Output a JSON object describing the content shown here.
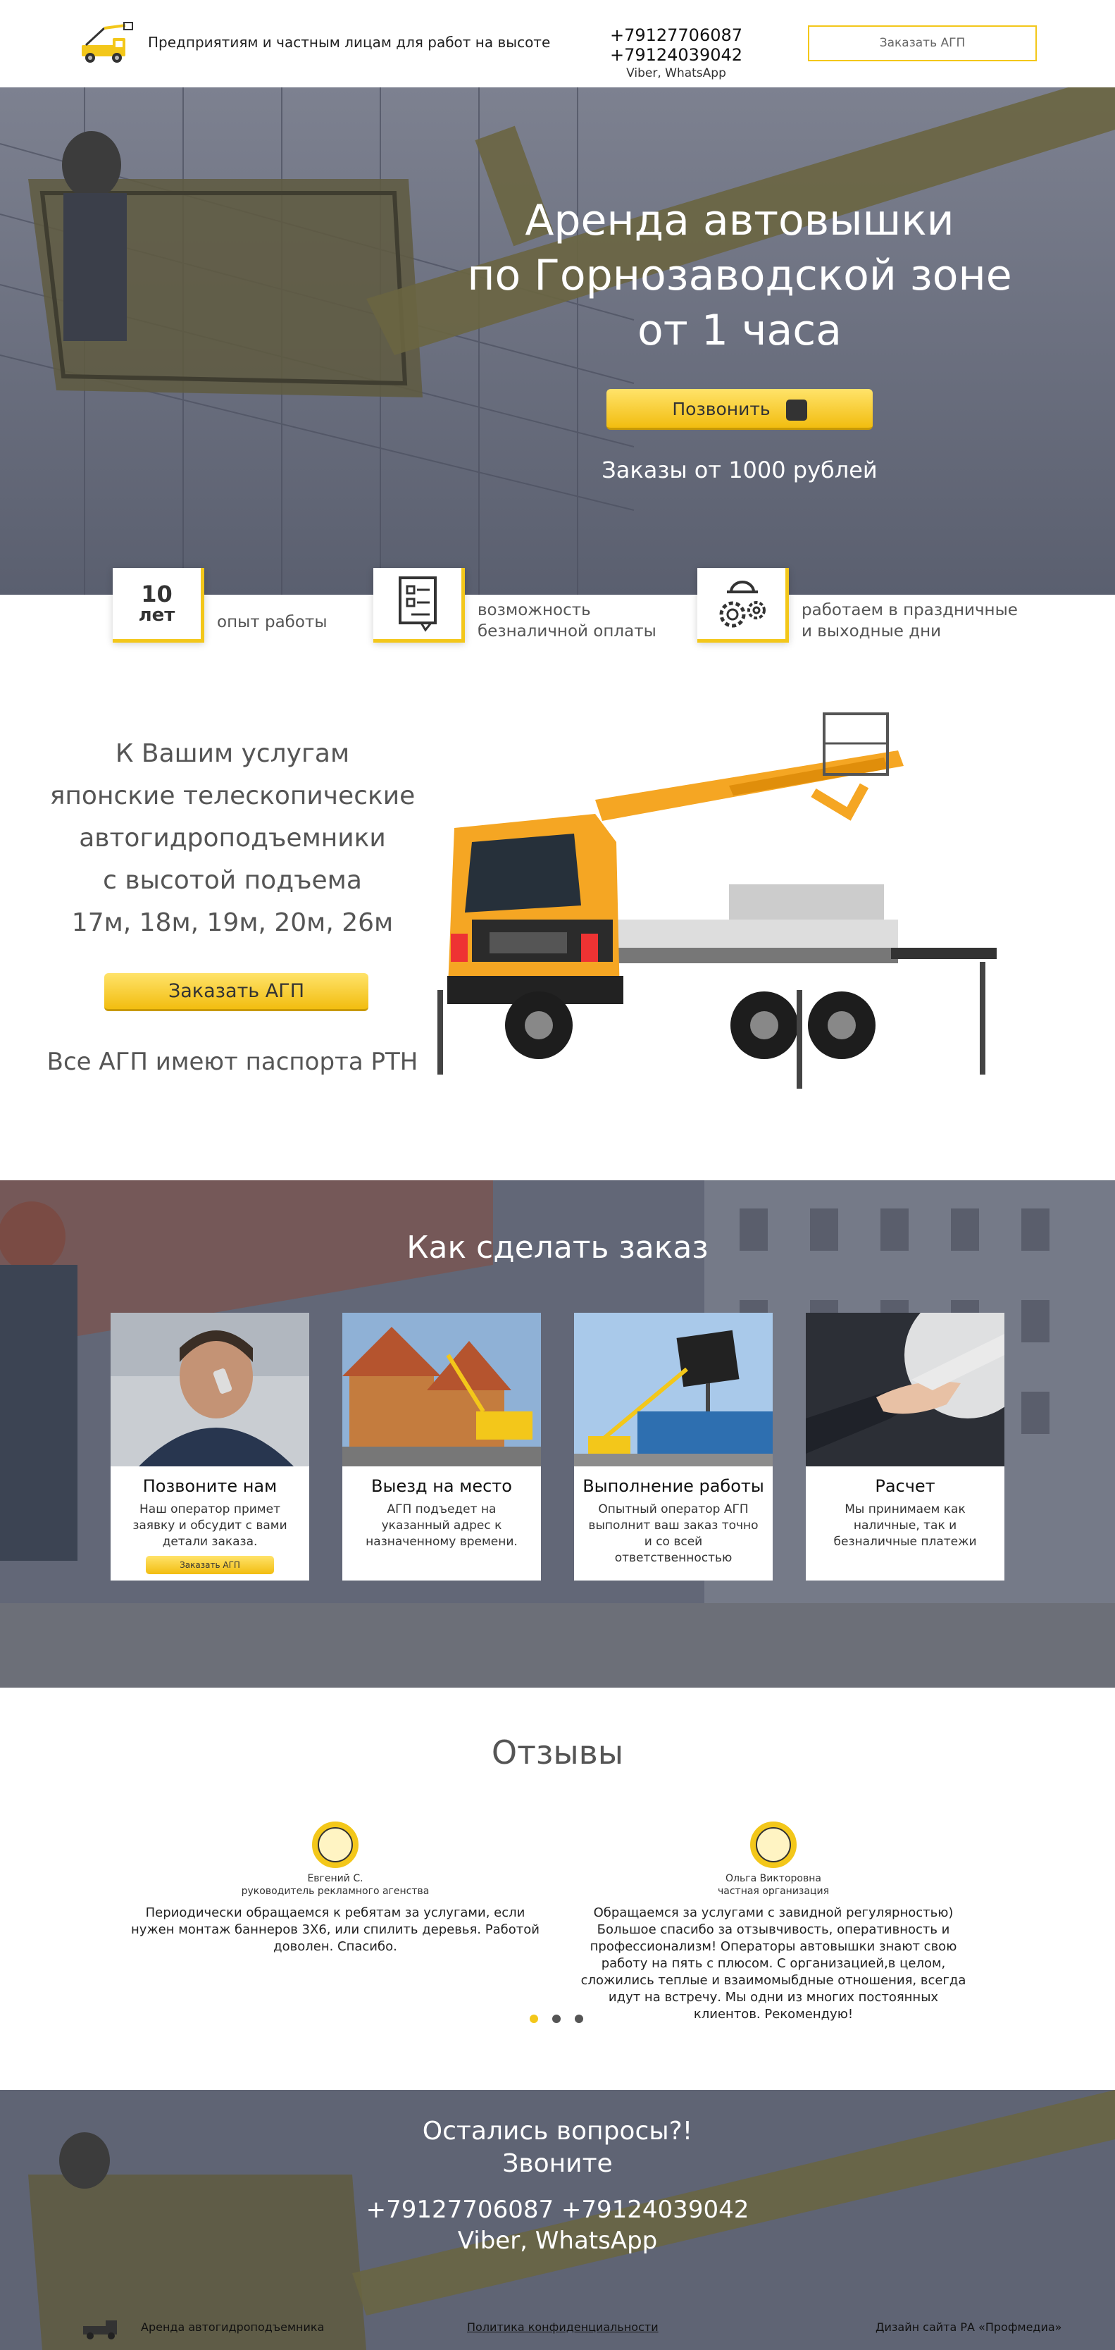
{
  "header": {
    "tagline": "Предприятиям и частным лицам для работ на высоте",
    "phones": "+79127706087  +79124039042",
    "messengers": "Viber, WhatsApp",
    "order_button": "Заказать АГП"
  },
  "hero": {
    "title_line1": "Аренда автовышки",
    "title_line2": "по Горнозаводской зоне",
    "title_line3": "от 1 часа",
    "call_button": "Позвонить",
    "subtitle": "Заказы от 1000 рублей"
  },
  "features": [
    {
      "badge_number": "10",
      "badge_unit": "лет",
      "text": "опыт работы",
      "icon": "ten-years-badge"
    },
    {
      "text_line1": "возможность",
      "text_line2": "безналичной оплаты",
      "icon": "document-checklist-icon"
    },
    {
      "text_line1": "работаем в праздничные",
      "text_line2": "и выходные дни",
      "icon": "gears-worker-icon"
    }
  ],
  "services": {
    "line1": "К Вашим услугам",
    "line2": "японские телескопические",
    "line3": "автогидроподъемники",
    "line4": "с высотой подъема",
    "line5": "17м, 18м, 19м, 20м, 26м",
    "order_button": "Заказать АГП",
    "note": "Все АГП имеют паспорта РТН"
  },
  "how_to_order": {
    "title": "Как сделать заказ",
    "cards": [
      {
        "title": "Позвоните нам",
        "text": "Наш оператор примет заявку и обсудит с вами детали заказа.",
        "button": "Заказать АГП"
      },
      {
        "title": "Выезд на место",
        "text": "АГП подъедет на указанный адрес к назначенному времени."
      },
      {
        "title": "Выполнение работы",
        "text": "Опытный оператор АГП выполнит ваш заказ точно и со всей ответственностью"
      },
      {
        "title": "Расчет",
        "text": "Мы принимаем как наличные, так и безналичные платежи"
      }
    ]
  },
  "reviews": {
    "title": "Отзывы",
    "items": [
      {
        "name": "Евгений С.",
        "role": "руководитель рекламного агенства",
        "text": "Периодически обращаемся к ребятам за услугами, если нужен монтаж баннеров 3Х6, или спилить деревья. Работой доволен. Спасибо."
      },
      {
        "name": "Ольга Викторовна",
        "role": "частная организация",
        "text": "Обращаемся за услугами с завидной регулярностью) Большое спасибо за отзывчивость, оперативность и профессионализм! Операторы автовышки знают свою работу на пять с плюсом. С организацией,в целом, сложились теплые и взаимомыбдные отношения, всегда идут на встречу. Мы одни из многих постоянных клиентов. Рекомендую!"
      }
    ],
    "active_dot": 0
  },
  "cta": {
    "line1": "Остались вопросы?!",
    "line2": "Звоните",
    "phones": "+79127706087 +79124039042",
    "messengers": "Viber, WhatsApp"
  },
  "footer": {
    "left": "Аренда автогидроподъемника",
    "privacy": "Политика конфиденциальности",
    "design": "Дизайн сайта РА «Профмедиа»"
  },
  "colors": {
    "accent": "#f3c71a",
    "overlay": "#5a5f6f"
  }
}
